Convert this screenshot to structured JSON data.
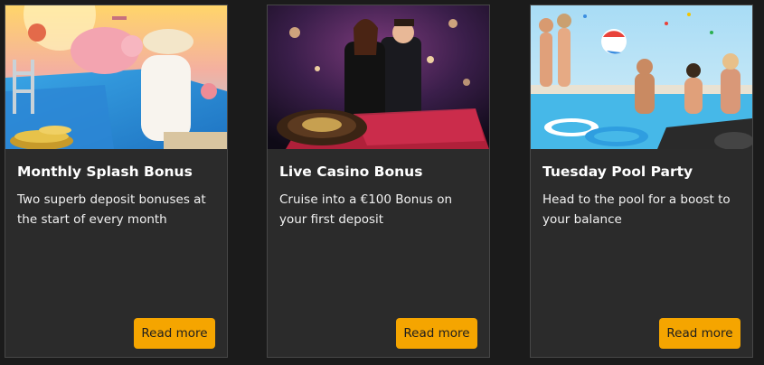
{
  "cards": [
    {
      "title": "Monthly Splash Bonus",
      "description": "Two superb deposit bonuses at the start of every month",
      "button_label": "Read more",
      "image_icon": "pool-piggy-bank-promo-image"
    },
    {
      "title": "Live Casino Bonus",
      "description": "Cruise into a €100 Bonus on your first deposit",
      "button_label": "Read more",
      "image_icon": "live-roulette-dealers-promo-image"
    },
    {
      "title": "Tuesday Pool Party",
      "description": "Head to the pool for a boost to your balance",
      "button_label": "Read more",
      "image_icon": "pool-party-promo-image"
    }
  ],
  "colors": {
    "page_bg": "#1b1b1b",
    "card_bg": "#2b2b2b",
    "card_border": "#474747",
    "button_bg": "#f5a500",
    "button_text": "#1e1e1e",
    "title_text": "#ffffff"
  }
}
